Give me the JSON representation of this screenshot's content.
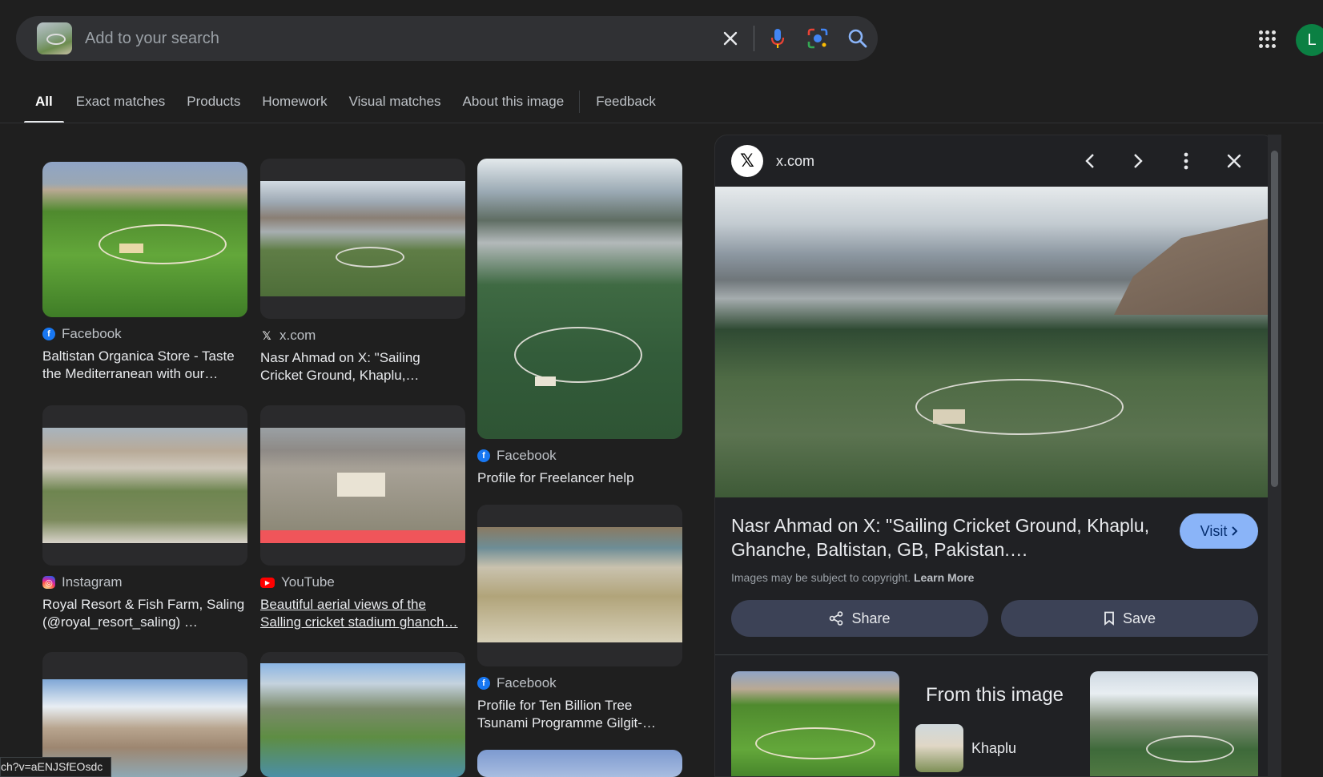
{
  "search": {
    "placeholder": "Add to your search"
  },
  "user": {
    "avatar_letter": "L"
  },
  "tabs": [
    {
      "label": "All"
    },
    {
      "label": "Exact matches"
    },
    {
      "label": "Products"
    },
    {
      "label": "Homework"
    },
    {
      "label": "Visual matches"
    },
    {
      "label": "About this image"
    },
    {
      "label": "Feedback"
    }
  ],
  "results": [
    {
      "source": "Facebook",
      "icon": "facebook-icon",
      "title": "Baltistan Organica Store - Taste the Mediterranean with our…"
    },
    {
      "source": "x.com",
      "icon": "x-icon",
      "title": "Nasr Ahmad on X: \"Sailing Cricket Ground, Khaplu,…"
    },
    {
      "source": "Facebook",
      "icon": "facebook-icon",
      "title": "Profile for Freelancer help"
    },
    {
      "source": "Instagram",
      "icon": "instagram-icon",
      "title": "Royal Resort & Fish Farm, Saling (@royal_resort_saling) …"
    },
    {
      "source": "YouTube",
      "icon": "youtube-icon",
      "title": "Beautiful aerial views of the Salling cricket stadium ghanch…"
    },
    {
      "source": "Facebook",
      "icon": "facebook-icon",
      "title": "Profile for Ten Billion Tree Tsunami Programme Gilgit-…"
    }
  ],
  "panel": {
    "site": "x.com",
    "title": "Nasr Ahmad on X: \"Sailing Cricket Ground, Khaplu, Ghanche, Baltistan, GB, Pakistan.…",
    "visit_label": "Visit",
    "copyright_text": "Images may be subject to copyright.",
    "learn_more": "Learn More",
    "share_label": "Share",
    "save_label": "Save",
    "from_image_title": "From this image",
    "chip_label": "Khaplu"
  },
  "status_url": "ch?v=aENJSfEOsdc",
  "colors": {
    "background": "#1f1f1f",
    "visit_button": "#8ab4f8",
    "action_button": "#3c4256"
  }
}
